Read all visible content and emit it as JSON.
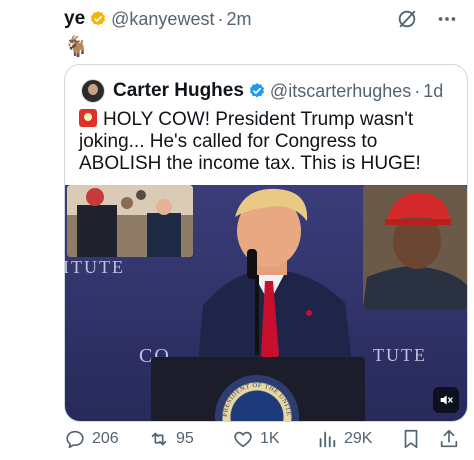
{
  "tweet": {
    "author_name": "ye",
    "handle": "@kanyewest",
    "separator": "·",
    "time": "2m",
    "text": "🐐"
  },
  "quote": {
    "author_name": "Carter Hughes",
    "handle": "@itscarterhughes",
    "separator": "·",
    "time": "1d",
    "text": "HOLY COW! President Trump wasn't joking... He's called for Congress to ABOLISH the income tax. This is HUGE!",
    "media": {
      "background_text_left": "ITUTE",
      "background_text_mid": "CO",
      "background_text_right": "TUTE",
      "seal_text": "PRESIDENT OF THE UNITED"
    }
  },
  "actions": {
    "replies": "206",
    "reposts": "95",
    "likes": "1K",
    "views": "29K"
  },
  "colors": {
    "verified": "#f4b400",
    "verified_blue": "#1d9bf0",
    "muted": "#536471",
    "border": "#cfd9de",
    "video_bg": "#34366f"
  }
}
